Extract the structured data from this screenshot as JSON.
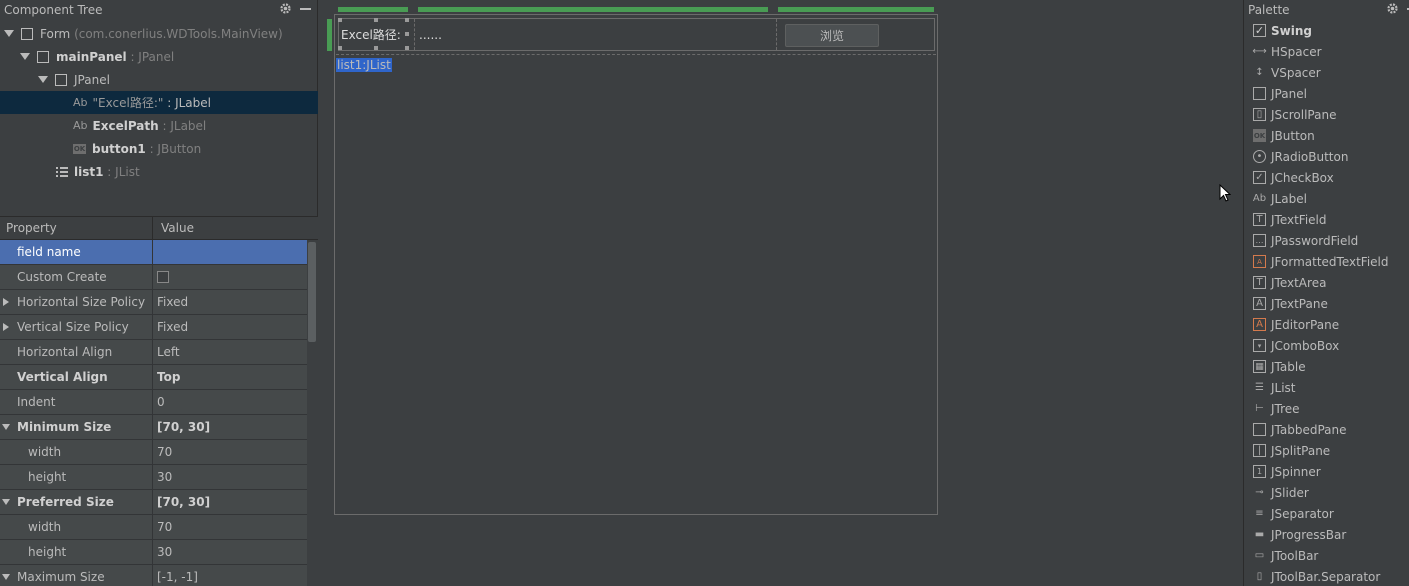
{
  "component_tree": {
    "title": "Component Tree",
    "rows": [
      {
        "name": "Form",
        "type": "(com.conerlius.WDTools.MainView)"
      },
      {
        "name": "mainPanel",
        "type": ": JPanel"
      },
      {
        "name": "JPanel",
        "type": ""
      },
      {
        "name": "\"Excel路径:\"",
        "type": ": JLabel",
        "prefix": "Ab"
      },
      {
        "name": "ExcelPath",
        "type": ": JLabel",
        "prefix": "Ab"
      },
      {
        "name": "button1",
        "type": ": JButton",
        "prefix": "OK"
      },
      {
        "name": "list1",
        "type": ": JList"
      }
    ]
  },
  "properties": {
    "header_property": "Property",
    "header_value": "Value",
    "rows": [
      {
        "name": "field name",
        "value": ""
      },
      {
        "name": "Custom Create",
        "value": ""
      },
      {
        "name": "Horizontal Size Policy",
        "value": "Fixed"
      },
      {
        "name": "Vertical Size Policy",
        "value": "Fixed"
      },
      {
        "name": "Horizontal Align",
        "value": "Left"
      },
      {
        "name": "Vertical Align",
        "value": "Top"
      },
      {
        "name": "Indent",
        "value": "0"
      },
      {
        "name": "Minimum Size",
        "value": "[70, 30]"
      },
      {
        "name": "width",
        "value": "70"
      },
      {
        "name": "height",
        "value": "30"
      },
      {
        "name": "Preferred Size",
        "value": "[70, 30]"
      },
      {
        "name": "width",
        "value": "70"
      },
      {
        "name": "height",
        "value": "30"
      },
      {
        "name": "Maximum Size",
        "value": "[-1, -1]"
      }
    ]
  },
  "designer": {
    "excel_label": "Excel路径:",
    "path_value": "......",
    "browse_button": "浏览",
    "list_label": "list1:JList"
  },
  "palette": {
    "title": "Palette",
    "group": "Swing",
    "items": [
      {
        "label": "HSpacer",
        "icon": "hspacer-icon"
      },
      {
        "label": "VSpacer",
        "icon": "vspacer-icon"
      },
      {
        "label": "JPanel",
        "icon": "jpanel-icon"
      },
      {
        "label": "JScrollPane",
        "icon": "jscrollpane-icon"
      },
      {
        "label": "JButton",
        "icon": "jbutton-icon"
      },
      {
        "label": "JRadioButton",
        "icon": "jradiobutton-icon"
      },
      {
        "label": "JCheckBox",
        "icon": "jcheckbox-icon"
      },
      {
        "label": "JLabel",
        "icon": "jlabel-icon"
      },
      {
        "label": "JTextField",
        "icon": "jtextfield-icon"
      },
      {
        "label": "JPasswordField",
        "icon": "jpasswordfield-icon"
      },
      {
        "label": "JFormattedTextField",
        "icon": "jformattedtextfield-icon"
      },
      {
        "label": "JTextArea",
        "icon": "jtextarea-icon"
      },
      {
        "label": "JTextPane",
        "icon": "jtextpane-icon"
      },
      {
        "label": "JEditorPane",
        "icon": "jeditorpane-icon"
      },
      {
        "label": "JComboBox",
        "icon": "jcombobox-icon"
      },
      {
        "label": "JTable",
        "icon": "jtable-icon"
      },
      {
        "label": "JList",
        "icon": "jlist-icon"
      },
      {
        "label": "JTree",
        "icon": "jtree-icon"
      },
      {
        "label": "JTabbedPane",
        "icon": "jtabbedpane-icon"
      },
      {
        "label": "JSplitPane",
        "icon": "jsplitpane-icon"
      },
      {
        "label": "JSpinner",
        "icon": "jspinner-icon"
      },
      {
        "label": "JSlider",
        "icon": "jslider-icon"
      },
      {
        "label": "JSeparator",
        "icon": "jseparator-icon"
      },
      {
        "label": "JProgressBar",
        "icon": "jprogressbar-icon"
      },
      {
        "label": "JToolBar",
        "icon": "jtoolbar-icon"
      },
      {
        "label": "JToolBar.Separator",
        "icon": "jtoolbar-separator-icon"
      }
    ]
  },
  "colors": {
    "background": "#3c3f41",
    "selection_tree": "#0d293e",
    "selection_property": "#4b6eaf",
    "designer_green": "#499c54",
    "list_highlight": "#2f65ca"
  }
}
